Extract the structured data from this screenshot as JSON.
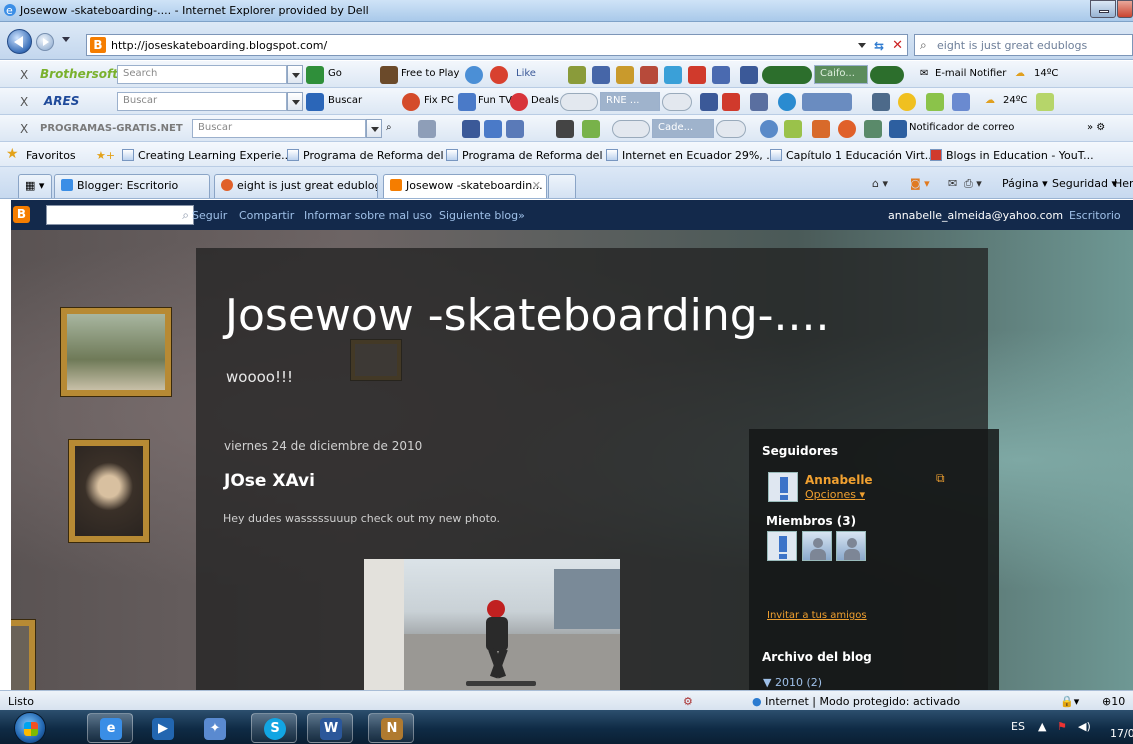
{
  "window": {
    "title": "Josewow -skateboarding-.... - Internet Explorer provided by Dell"
  },
  "address": {
    "url": "http://joseskateboarding.blogspot.com/",
    "search_placeholder": "eight is just great edublogs"
  },
  "toolbar_brothersoft": {
    "close": "X",
    "brand": "Brothersoft",
    "search_placeholder": "Search",
    "go": "Go",
    "free_to_play": "Free to Play",
    "like": "Like",
    "radio_station": "Caifo...",
    "email_notifier": "E-mail Notifier",
    "temperature": "14ºC"
  },
  "toolbar_ares": {
    "close": "X",
    "brand": "ARES",
    "search_placeholder": "Buscar",
    "buscar_btn": "Buscar",
    "fix_pc": "Fix PC",
    "fun_tv": "Fun TV",
    "deals": "Deals",
    "radio_station": "RNE ...",
    "temperature": "24ºC"
  },
  "toolbar_programas": {
    "close": "X",
    "brand": "PROGRAMAS-GRATIS.NET",
    "search_placeholder": "Buscar",
    "radio_station": "Cade...",
    "mail_notifier": "Notificador de correo"
  },
  "favorites": {
    "label": "Favoritos",
    "links": [
      "Creating Learning Experie...",
      "Programa de Reforma del ...",
      "Programa de Reforma del ...",
      "Internet en Ecuador 29%, ...",
      "Capítulo 1 Educación Virt...",
      "Blogs in Education - YouT..."
    ]
  },
  "tabs": [
    {
      "label": "Blogger: Escritorio"
    },
    {
      "label": "eight is just great edublog..."
    },
    {
      "label": "Josewow -skateboardin..."
    }
  ],
  "commandbar": {
    "page": "Página",
    "safety": "Seguridad",
    "tools": "Herramientas"
  },
  "blogger_nav": {
    "links": [
      "Seguir",
      "Compartir",
      "Informar sobre mal uso",
      "Siguiente blog»"
    ],
    "user_email": "annabelle_almeida@yahoo.com",
    "dashboard": "Escritorio"
  },
  "blog": {
    "title": "Josewow -skateboarding-....",
    "description": "woooo!!!",
    "post_date": "viernes 24 de diciembre de 2010",
    "post_title": "JOse XAvi",
    "post_body": "Hey dudes wasssssuuup check out my new photo."
  },
  "sidebar": {
    "followers_title": "Seguidores",
    "follower_name": "Annabelle",
    "options": "Opciones",
    "members": "Miembros (3)",
    "invite": "Invitar a tus amigos",
    "archive_title": "Archivo del blog",
    "archive_year": "▼ 2010 (2)"
  },
  "statusbar": {
    "status": "Listo",
    "zone": "Internet | Modo protegido: activado",
    "zoom": "10"
  },
  "tray": {
    "language": "ES",
    "date": "17/0"
  },
  "colors": {
    "blogger_orange": "#f57d00",
    "nav_blue": "#13294b",
    "link_orange": "#f0a030"
  }
}
